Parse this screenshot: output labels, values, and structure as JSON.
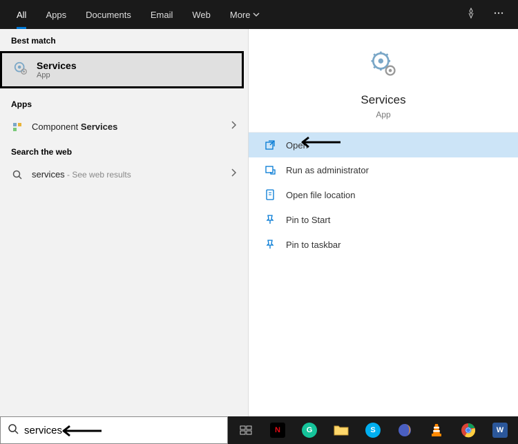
{
  "tabs": [
    {
      "label": "All",
      "active": true
    },
    {
      "label": "Apps",
      "active": false
    },
    {
      "label": "Documents",
      "active": false
    },
    {
      "label": "Email",
      "active": false
    },
    {
      "label": "Web",
      "active": false
    },
    {
      "label": "More",
      "active": false,
      "hasDropdown": true
    }
  ],
  "sections": {
    "bestMatch": "Best match",
    "apps": "Apps",
    "searchWeb": "Search the web"
  },
  "bestMatch": {
    "title": "Services",
    "subtitle": "App"
  },
  "appsList": [
    {
      "prefix": "Component ",
      "bold": "Services"
    }
  ],
  "webList": [
    {
      "query": "services",
      "hint": " - See web results"
    }
  ],
  "preview": {
    "title": "Services",
    "subtitle": "App"
  },
  "actions": [
    {
      "label": "Open",
      "icon": "open",
      "selected": true
    },
    {
      "label": "Run as administrator",
      "icon": "admin",
      "selected": false
    },
    {
      "label": "Open file location",
      "icon": "folder",
      "selected": false
    },
    {
      "label": "Pin to Start",
      "icon": "pin",
      "selected": false
    },
    {
      "label": "Pin to taskbar",
      "icon": "pin",
      "selected": false
    }
  ],
  "search": {
    "value": "services"
  },
  "taskbar": [
    {
      "name": "task-view",
      "type": "svg"
    },
    {
      "name": "netflix",
      "color": "#e50914",
      "letter": "N"
    },
    {
      "name": "grammarly",
      "color": "#15c39a",
      "letter": "G"
    },
    {
      "name": "explorer",
      "type": "folder"
    },
    {
      "name": "skype",
      "color": "#00aff0",
      "letter": "S"
    },
    {
      "name": "firefox",
      "type": "firefox"
    },
    {
      "name": "vlc",
      "type": "vlc"
    },
    {
      "name": "chrome",
      "type": "chrome"
    },
    {
      "name": "word",
      "color": "#2b579a",
      "letter": "W"
    }
  ]
}
